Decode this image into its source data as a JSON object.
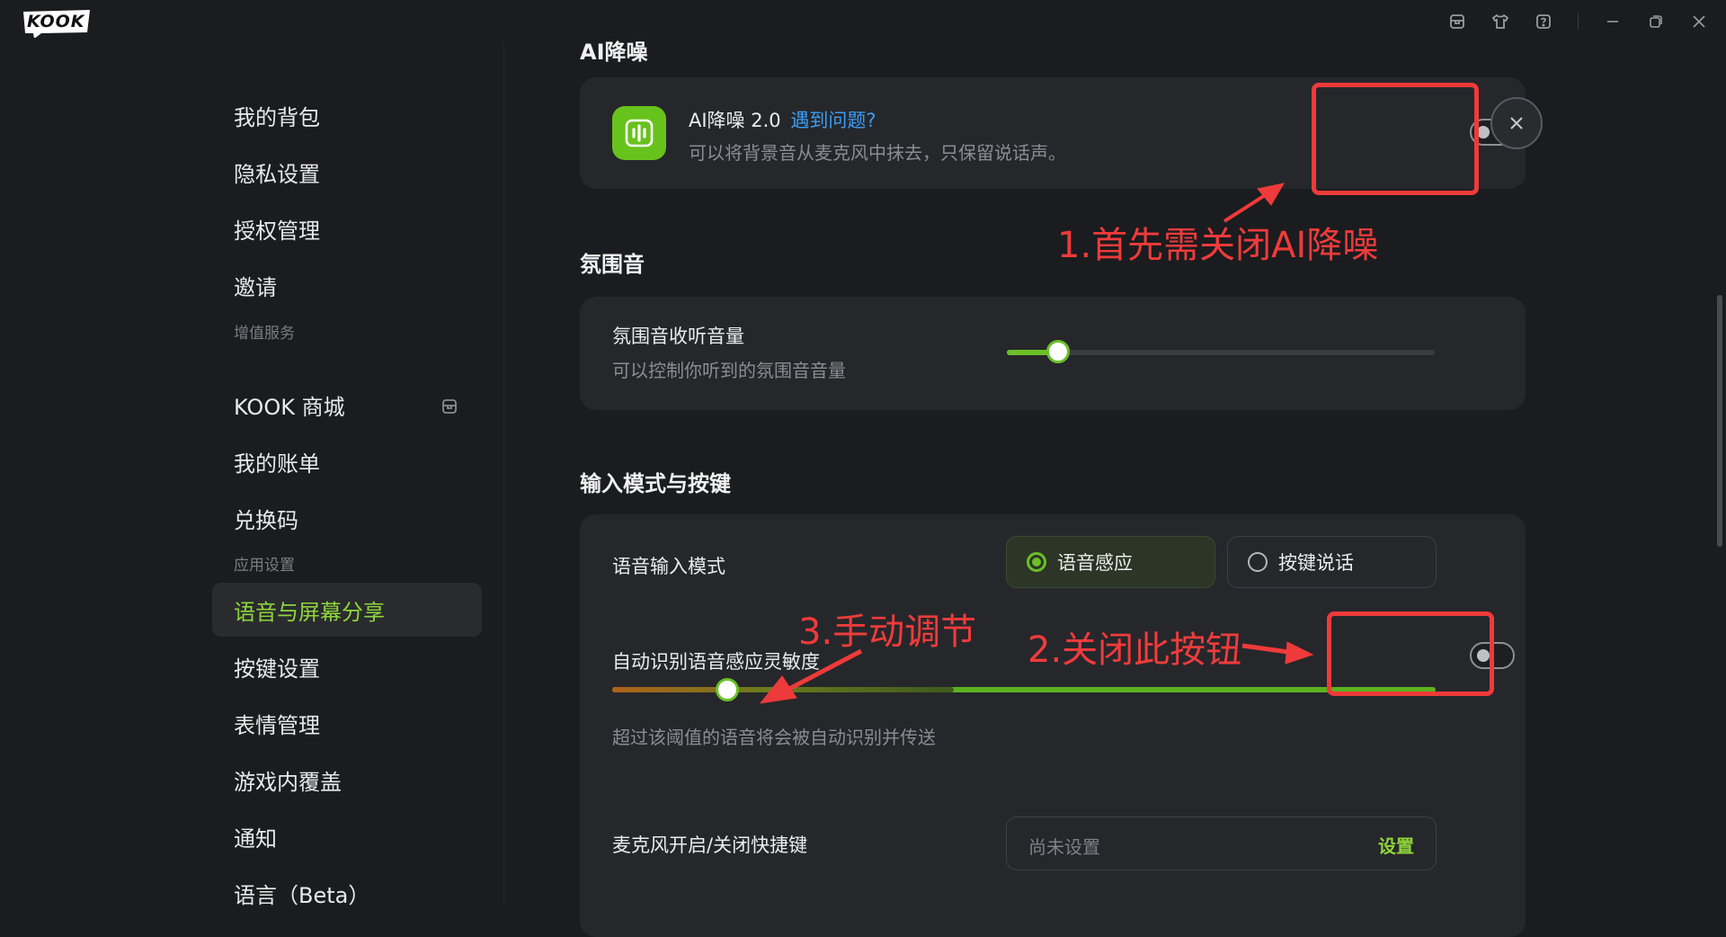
{
  "app": {
    "logo_text": "KOOK"
  },
  "titlebar": {
    "icons": [
      "store-icon",
      "shirt-icon",
      "help-icon",
      "minimize-icon",
      "restore-icon",
      "close-icon"
    ]
  },
  "sidebar": {
    "items_top": [
      {
        "label": "我的背包"
      },
      {
        "label": "隐私设置"
      },
      {
        "label": "授权管理"
      },
      {
        "label": "邀请"
      }
    ],
    "group_value_added": "增值服务",
    "items_value_added": [
      {
        "label": "KOOK 商城"
      },
      {
        "label": "我的账单"
      },
      {
        "label": "兑换码"
      }
    ],
    "group_app_settings": "应用设置",
    "items_app_settings": [
      {
        "label": "语音与屏幕分享",
        "active": true
      },
      {
        "label": "按键设置"
      },
      {
        "label": "表情管理"
      },
      {
        "label": "游戏内覆盖"
      },
      {
        "label": "通知"
      },
      {
        "label": "语言（Beta）"
      }
    ]
  },
  "main": {
    "ai_section_title": "AI降噪",
    "ai_card": {
      "title": "AI降噪 2.0",
      "link": "遇到问题?",
      "desc": "可以将背景音从麦克风中抹去，只保留说话声。",
      "toggle_on": false
    },
    "ambient_section_title": "氛围音",
    "ambient_card": {
      "label": "氛围音收听音量",
      "desc": "可以控制你听到的氛围音音量",
      "volume_fraction": 0.12
    },
    "input_section_title": "输入模式与按键",
    "input_card": {
      "mode_label": "语音输入模式",
      "mode_options": [
        "语音感应",
        "按键说话"
      ],
      "mode_selected": "语音感应",
      "auto_label": "自动识别语音感应灵敏度",
      "auto_toggle_on": false,
      "sensitivity_fraction": 0.14,
      "threshold_desc": "超过该阈值的语音将会被自动识别并传送",
      "hotkey_label": "麦克风开启/关闭快捷键",
      "hotkey_placeholder": "尚未设置",
      "hotkey_set_button": "设置"
    }
  },
  "annotations": {
    "a1": "1.首先需关闭AI降噪",
    "a2": "2.关闭此按钮",
    "a3": "3.手动调节",
    "color": "#ef3b3b"
  },
  "colors": {
    "accent": "#6bbf27",
    "accent_text": "#8ed53b",
    "link": "#3a9df5"
  }
}
